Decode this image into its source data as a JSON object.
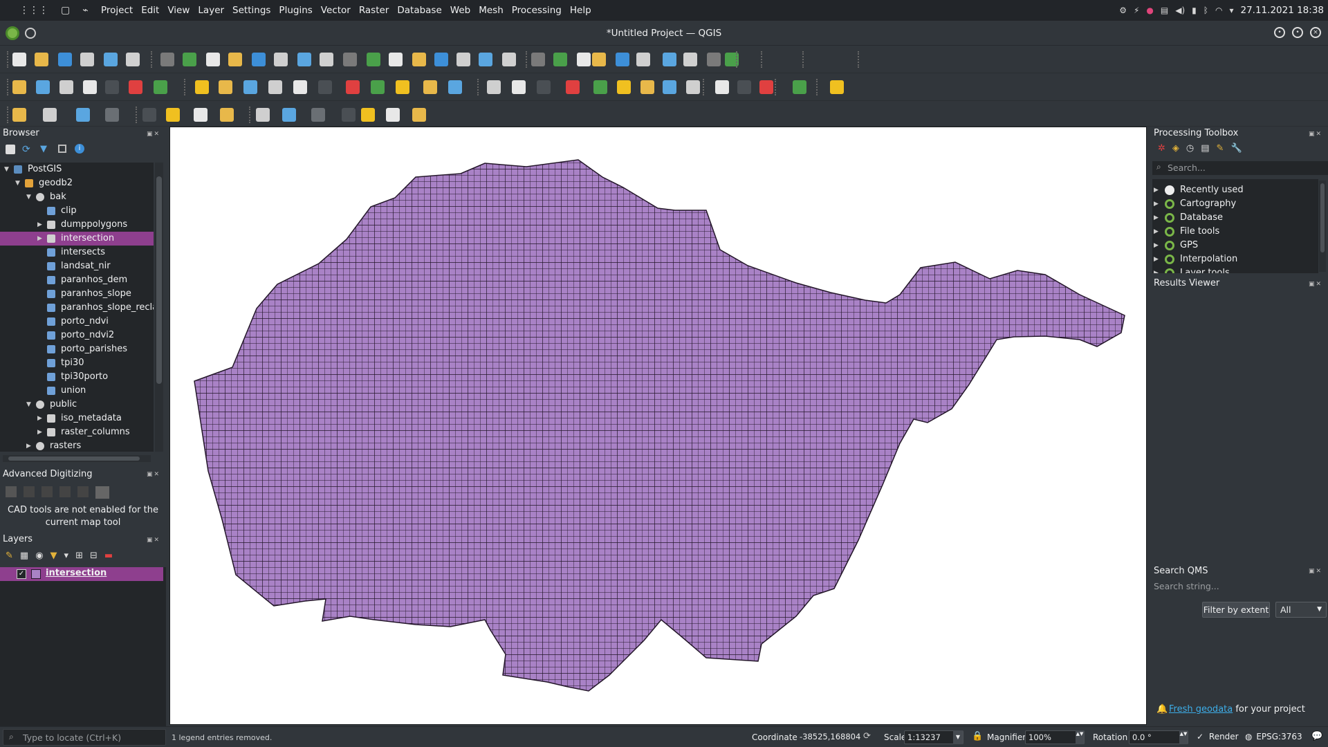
{
  "system_bar": {
    "menu": [
      "Project",
      "Edit",
      "View",
      "Layer",
      "Settings",
      "Plugins",
      "Vector",
      "Raster",
      "Database",
      "Web",
      "Mesh",
      "Processing",
      "Help"
    ],
    "datetime": "27.11.2021  18:38"
  },
  "window": {
    "title": "*Untitled Project — QGIS"
  },
  "browser": {
    "title": "Browser",
    "tree": [
      {
        "label": "PostGIS",
        "depth": 0,
        "icon": "postgis-icon",
        "expander": "down"
      },
      {
        "label": "geodb2",
        "depth": 1,
        "icon": "connection-icon",
        "expander": "down"
      },
      {
        "label": "bak",
        "depth": 2,
        "icon": "schema-icon",
        "expander": "down"
      },
      {
        "label": "clip",
        "depth": 3,
        "icon": "raster-layer-icon",
        "expander": ""
      },
      {
        "label": "dumppolygons",
        "depth": 3,
        "icon": "polygon-layer-icon",
        "expander": "right"
      },
      {
        "label": "intersection",
        "depth": 3,
        "icon": "polygon-layer-icon",
        "expander": "right",
        "selected": true
      },
      {
        "label": "intersects",
        "depth": 3,
        "icon": "raster-layer-icon",
        "expander": ""
      },
      {
        "label": "landsat_nir",
        "depth": 3,
        "icon": "raster-layer-icon",
        "expander": ""
      },
      {
        "label": "paranhos_dem",
        "depth": 3,
        "icon": "raster-layer-icon",
        "expander": ""
      },
      {
        "label": "paranhos_slope",
        "depth": 3,
        "icon": "raster-layer-icon",
        "expander": ""
      },
      {
        "label": "paranhos_slope_recla:",
        "depth": 3,
        "icon": "raster-layer-icon",
        "expander": ""
      },
      {
        "label": "porto_ndvi",
        "depth": 3,
        "icon": "raster-layer-icon",
        "expander": ""
      },
      {
        "label": "porto_ndvi2",
        "depth": 3,
        "icon": "raster-layer-icon",
        "expander": ""
      },
      {
        "label": "porto_parishes",
        "depth": 3,
        "icon": "raster-layer-icon",
        "expander": ""
      },
      {
        "label": "tpi30",
        "depth": 3,
        "icon": "raster-layer-icon",
        "expander": ""
      },
      {
        "label": "tpi30porto",
        "depth": 3,
        "icon": "raster-layer-icon",
        "expander": ""
      },
      {
        "label": "union",
        "depth": 3,
        "icon": "raster-layer-icon",
        "expander": ""
      },
      {
        "label": "public",
        "depth": 2,
        "icon": "schema-icon",
        "expander": "down"
      },
      {
        "label": "iso_metadata",
        "depth": 3,
        "icon": "table-icon",
        "expander": "right"
      },
      {
        "label": "raster_columns",
        "depth": 3,
        "icon": "polygon-layer-icon",
        "expander": "right"
      },
      {
        "label": "rasters",
        "depth": 2,
        "icon": "schema-icon",
        "expander": "right"
      }
    ]
  },
  "advanced_digitizing": {
    "title": "Advanced Digitizing",
    "message_line1": "CAD tools are not enabled for the",
    "message_line2": "current map tool"
  },
  "layers": {
    "title": "Layers",
    "items": [
      {
        "label": "intersection",
        "checked": true,
        "color": "#a982c6"
      }
    ]
  },
  "processing_toolbox": {
    "title": "Processing Toolbox",
    "search_placeholder": "Search...",
    "groups": [
      "Recently used",
      "Cartography",
      "Database",
      "File tools",
      "GPS",
      "Interpolation",
      "Layer tools"
    ]
  },
  "results_viewer": {
    "title": "Results Viewer"
  },
  "search_qms": {
    "title": "Search QMS",
    "search_placeholder": "Search string...",
    "filter_button": "Filter by extent",
    "filter_select": "All",
    "fresh_link": "Fresh geodata",
    "fresh_suffix": " for your project"
  },
  "status_bar": {
    "locator_placeholder": "Type to locate (Ctrl+K)",
    "message": "1 legend entries removed.",
    "coordinate_label": "Coordinate",
    "coordinate_value": "-38525,168804",
    "scale_label": "Scale",
    "scale_value": "1:13237",
    "magnifier_label": "Magnifier",
    "magnifier_value": "100%",
    "rotation_label": "Rotation",
    "rotation_value": "0.0 °",
    "render_label": "Render",
    "crs": "EPSG:3763"
  },
  "colors": {
    "polygon_fill": "#a982c6",
    "polygon_stroke": "#231629",
    "selection": "#8e3f8e",
    "link": "#3daee9"
  }
}
